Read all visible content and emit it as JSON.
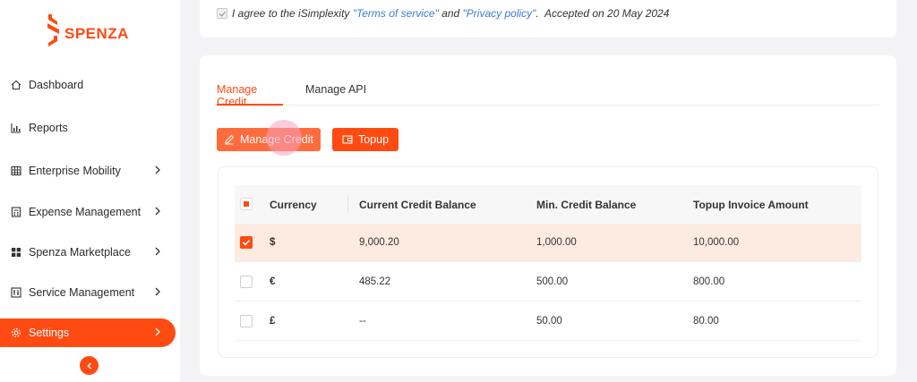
{
  "brand": {
    "name": "SPENZA",
    "color": "#ff4b12"
  },
  "sidebar": {
    "items": [
      {
        "label": "Dashboard",
        "icon": "home-icon",
        "has_children": false
      },
      {
        "label": "Reports",
        "icon": "bar-chart-icon",
        "has_children": false
      },
      {
        "label": "Enterprise Mobility",
        "icon": "grid-icon",
        "has_children": true
      },
      {
        "label": "Expense Management",
        "icon": "calculator-icon",
        "has_children": true
      },
      {
        "label": "Spenza Marketplace",
        "icon": "apps-icon",
        "has_children": true
      },
      {
        "label": "Service Management",
        "icon": "tools-icon",
        "has_children": true
      },
      {
        "label": "Settings",
        "icon": "gear-icon",
        "has_children": true,
        "active": true
      }
    ],
    "collapse_icon": "chevron-left-icon"
  },
  "agreement": {
    "prefix": "I agree to the iSimplexity ",
    "terms_link": "\"Terms of service\"",
    "and": " and ",
    "privacy_link": "\"Privacy policy\"",
    "suffix": ".  Accepted on 20 May 2024",
    "checked": true
  },
  "tabs": [
    {
      "label": "Manage Credit",
      "active": true
    },
    {
      "label": "Manage API",
      "active": false
    }
  ],
  "actions": {
    "manage_credit_label": "Manage Credit",
    "manage_credit_icon": "pencil-icon",
    "topup_label": "Topup",
    "topup_icon": "wallet-icon"
  },
  "table": {
    "columns": [
      "Currency",
      "Current Credit Balance",
      "Min. Credit Balance",
      "Topup Invoice Amount"
    ],
    "rows": [
      {
        "selected": true,
        "currency": "$",
        "current": "9,000.20",
        "min": "1,000.00",
        "topup": "10,000.00"
      },
      {
        "selected": false,
        "currency": "€",
        "current": "485.22",
        "min": "500.00",
        "topup": "800.00"
      },
      {
        "selected": false,
        "currency": "£",
        "current": "--",
        "min": "50.00",
        "topup": "80.00"
      }
    ]
  }
}
